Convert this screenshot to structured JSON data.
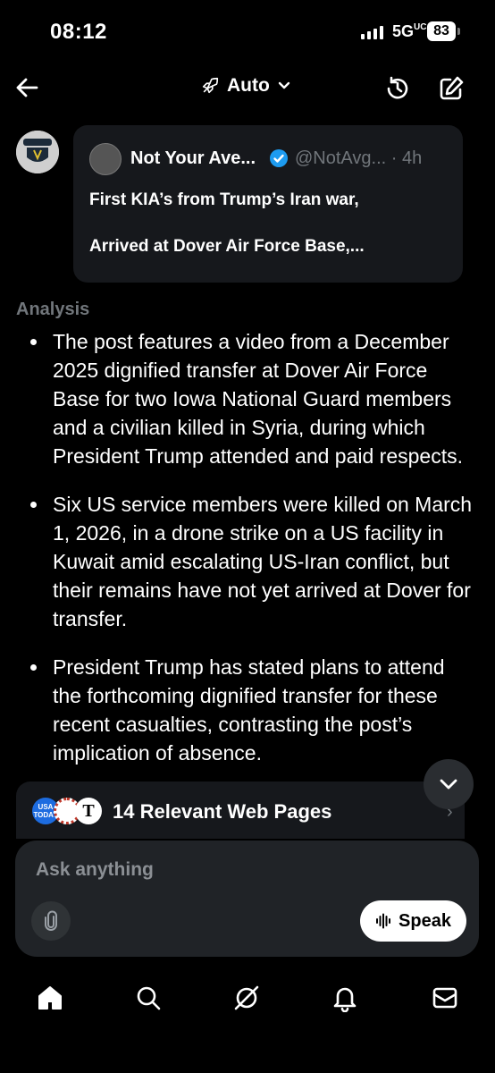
{
  "status_bar": {
    "time": "08:12",
    "network": "5G",
    "network_sup": "UC",
    "battery": "83"
  },
  "nav": {
    "mode_label": "Auto"
  },
  "quoted_post": {
    "author_name": "Not Your Ave...",
    "handle_time": "@NotAvg... · 4h",
    "line1": "First KIA’s from Trump’s Iran war,",
    "line2": "Arrived at Dover Air Force Base,..."
  },
  "analysis": {
    "heading": "Analysis",
    "bullets": [
      "The post features a video from a December 2025 dignified transfer at Dover Air Force Base for two Iowa National Guard members and a civilian killed in Syria, during which President Trump attended and paid respects.",
      "Six US service members were killed on March 1, 2026, in a drone strike on a US facility in Kuwait amid escalating US-Iran conflict, but their remains have not yet arrived at Dover for transfer.",
      "President Trump has stated plans to attend the forthcoming dignified transfer for these recent casualties, contrasting the post’s implication of absence."
    ]
  },
  "web_pages": {
    "label": "14 Relevant Web Pages",
    "favicon1_text": "USA TODAY",
    "favicon3_text": "T"
  },
  "composer": {
    "placeholder": "Ask anything",
    "speak_label": "Speak"
  },
  "colors": {
    "background": "#000000",
    "card": "#16181c",
    "muted": "#71767b",
    "verified": "#1d9bf0",
    "composer": "#202327"
  }
}
